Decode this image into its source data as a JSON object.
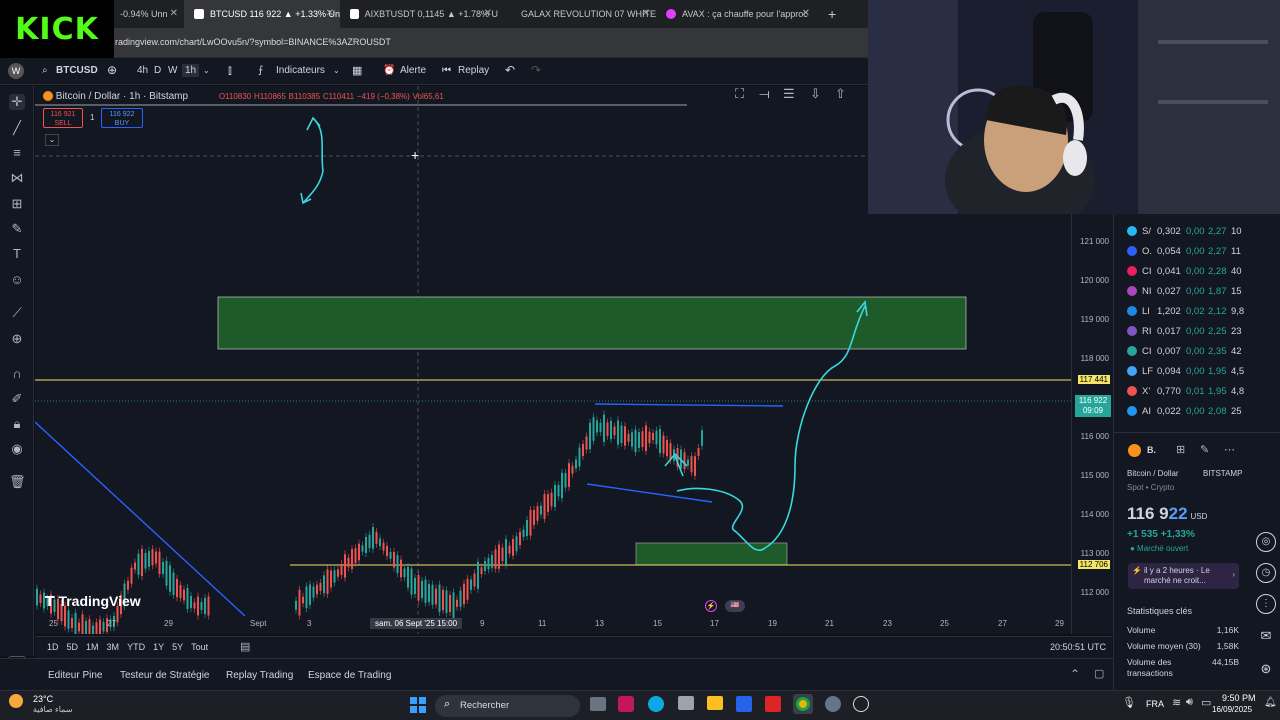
{
  "browser": {
    "tabs": [
      {
        "label": "-0.94% Unn",
        "active": false
      },
      {
        "label": "BTCUSD 116 922 ▲ +1.33% Un",
        "active": true
      },
      {
        "label": "AIXBTUSDT 0,1145 ▲ +1.78% U",
        "active": false
      },
      {
        "label": "GALAX REVOLUTION 07 WHITE",
        "active": false
      },
      {
        "label": "AVAX : ça chauffe pour l'approc",
        "active": false
      }
    ],
    "url": "radingview.com/chart/LwOOvu5n/?symbol=BINANCE%3AZROUSDT",
    "brand": "KICK"
  },
  "toolbar": {
    "symbol": "BTCUSD",
    "intervals": [
      "4h",
      "D",
      "W",
      "1h"
    ],
    "indicators": "Indicateurs",
    "alert": "Alerte",
    "replay": "Replay"
  },
  "legend": {
    "title": "Bitcoin / Dollar · 1h · Bitstamp",
    "o": "O110830",
    "h": "H110865",
    "l": "B110385",
    "c": "C110411",
    "chg": "−419 (−0,38%)",
    "vol": "Vol65,61",
    "sell_price": "116 921",
    "sell_label": "SELL",
    "qty": "1",
    "buy_price": "116 922",
    "buy_label": "BUY"
  },
  "price_axis": {
    "labels": [
      "121 000",
      "120 000",
      "119 000",
      "118 000",
      "117 441",
      "116 922",
      "116 000",
      "115 000",
      "114 000",
      "113 000",
      "112 706",
      "112 000"
    ],
    "current_time": "09:09",
    "current": "116 922",
    "yellow_upper": "117 441",
    "yellow_lower": "112 706"
  },
  "time_axis": {
    "labels": [
      "25",
      "27",
      "29",
      "Sept",
      "3",
      "9",
      "11",
      "13",
      "15",
      "17",
      "19",
      "21",
      "23",
      "25",
      "27",
      "29"
    ],
    "crosshair_label": "sam. 06 Sept '25   15:00"
  },
  "bottom": {
    "ranges": [
      "1D",
      "5D",
      "1M",
      "3M",
      "YTD",
      "1Y",
      "5Y",
      "Tout"
    ],
    "clock": "20:50:51 UTC"
  },
  "tv_tabs": [
    "Editeur Pine",
    "Testeur de Stratégie",
    "Replay Trading",
    "Espace de Trading"
  ],
  "watermark": "TradingView",
  "watchlist": [
    {
      "sym": "S/",
      "last": "0,302",
      "chg": "0,00",
      "pct": "2,27",
      "vol": "10",
      "color": "#29b6f6"
    },
    {
      "sym": "O.",
      "last": "0,054",
      "chg": "0,00",
      "pct": "2,27",
      "vol": "11",
      "color": "#2962ff"
    },
    {
      "sym": "CI",
      "last": "0,041",
      "chg": "0,00",
      "pct": "2,28",
      "vol": "40",
      "color": "#e91e63"
    },
    {
      "sym": "NI",
      "last": "0,027",
      "chg": "0,00",
      "pct": "1,87",
      "vol": "15",
      "color": "#ab47bc"
    },
    {
      "sym": "LI",
      "last": "1,202",
      "chg": "0,02",
      "pct": "2,12",
      "vol": "9,8",
      "color": "#1e88e5"
    },
    {
      "sym": "RI",
      "last": "0,017",
      "chg": "0,00",
      "pct": "2,25",
      "vol": "23",
      "color": "#7e57c2"
    },
    {
      "sym": "CI",
      "last": "0,007",
      "chg": "0,00",
      "pct": "2,35",
      "vol": "42",
      "color": "#26a69a"
    },
    {
      "sym": "LF",
      "last": "0,094",
      "chg": "0,00",
      "pct": "1,95",
      "vol": "4,5",
      "color": "#42a5f5"
    },
    {
      "sym": "X'",
      "last": "0,770",
      "chg": "0,01",
      "pct": "1,95",
      "vol": "4,8",
      "color": "#ef5350"
    },
    {
      "sym": "AI",
      "last": "0,022",
      "chg": "0,00",
      "pct": "2,08",
      "vol": "25",
      "color": "#2196f3"
    }
  ],
  "detail": {
    "short": "B.",
    "name": "Bitcoin / Dollar",
    "exchange": "BITSTAMP",
    "type": "Spot • Crypto",
    "price_main": "116 9",
    "price_dec": "22",
    "currency": "USD",
    "change": "+1 535  +1,33%",
    "status": "● Marché ouvert",
    "news": "il y a 2 heures · Le marché ne croit...",
    "stats_title": "Statistiques clés",
    "stats": [
      {
        "label": "Volume",
        "value": "1,16K"
      },
      {
        "label": "Volume moyen (30)",
        "value": "1,58K"
      },
      {
        "label": "Volume des transactions",
        "value": "44,15B"
      }
    ]
  },
  "taskbar": {
    "temp": "23°C",
    "weather": "سماء صافية",
    "search": "Rechercher",
    "lang": "FRA",
    "time": "9:50 PM",
    "date": "16/09/2025"
  },
  "colors": {
    "green_zone": "#1f5a2a",
    "cyan_arrow": "#38d8e0",
    "blue_line": "#2962ff",
    "yellow_line": "#f5e66a",
    "up": "#26a69a",
    "down": "#ef5350"
  }
}
